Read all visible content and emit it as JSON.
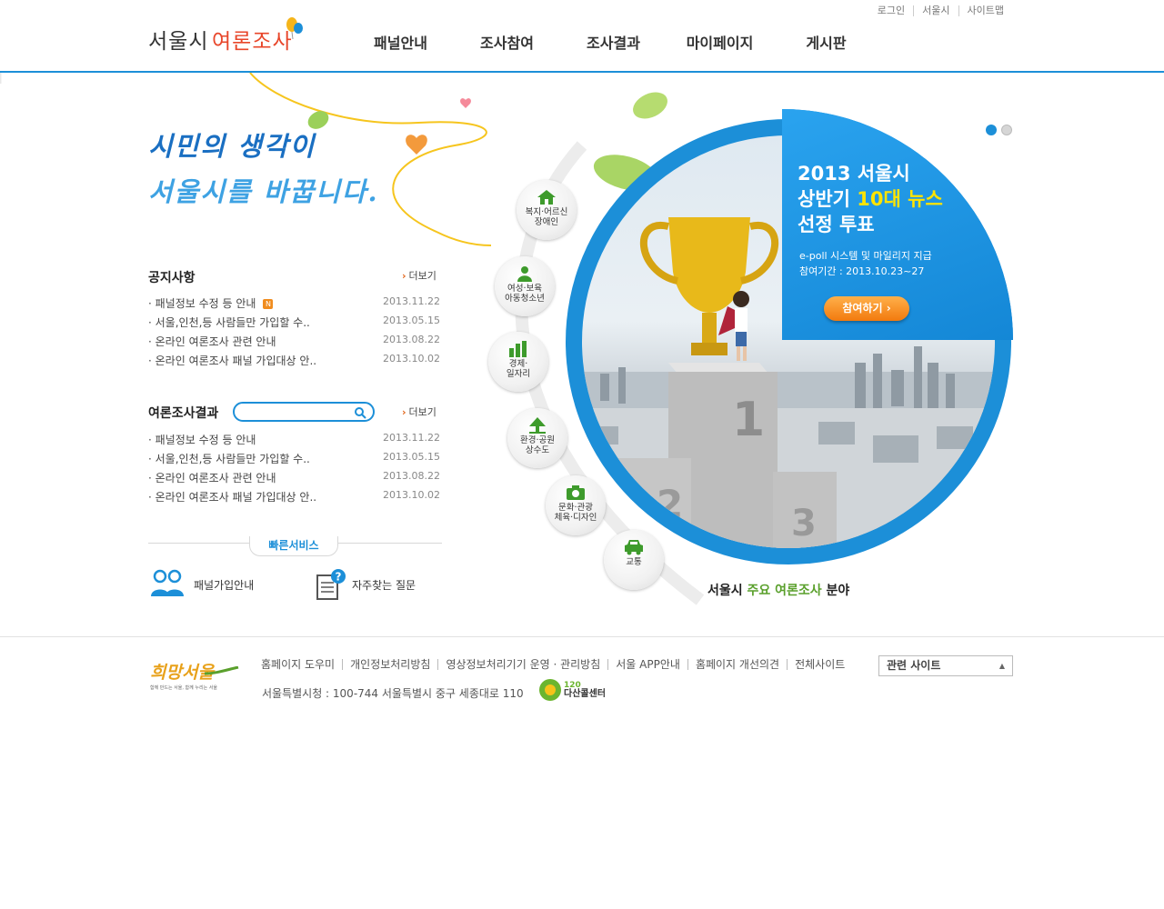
{
  "logo": {
    "part1": "서울시",
    "part2": "여론조사"
  },
  "utility": [
    "로그인",
    "서울시",
    "사이트맵"
  ],
  "gnb": [
    "패널안내",
    "조사참여",
    "조사결과",
    "마이페이지",
    "게시판"
  ],
  "slogan": {
    "line1": "시민의 생각이",
    "line2": "서울시를 바꿉니다."
  },
  "notice": {
    "title": "공지사항",
    "more": "더보기",
    "new_badge": "N",
    "items": [
      {
        "title": "· 패널정보 수정 등 안내",
        "date": "2013.11.22",
        "is_new": true
      },
      {
        "title": "· 서울,인천,등 사람들만 가입할 수..",
        "date": "2013.05.15"
      },
      {
        "title": "· 온라인 여론조사 관련 안내",
        "date": "2013.08.22"
      },
      {
        "title": "· 온라인 여론조사 패널 가입대상 안..",
        "date": "2013.10.02"
      }
    ]
  },
  "results": {
    "title": "여론조사결과",
    "more": "더보기",
    "search_value": "",
    "items": [
      {
        "title": "· 패널정보 수정 등 안내",
        "date": "2013.11.22"
      },
      {
        "title": "· 서울,인천,등 사람들만 가입할 수..",
        "date": "2013.05.15"
      },
      {
        "title": "· 온라인 여론조사 관련 안내",
        "date": "2013.08.22"
      },
      {
        "title": "· 온라인 여론조사 패널 가입대상 안..",
        "date": "2013.10.02"
      }
    ]
  },
  "quick": {
    "title": "빠른서비스",
    "items": [
      "패널가입안내",
      "자주찾는 질문"
    ]
  },
  "categories": [
    {
      "line1": "복지·어르신",
      "line2": "장애인",
      "icon": "house-icon"
    },
    {
      "line1": "여성·보육",
      "line2": "아동청소년",
      "icon": "person-icon"
    },
    {
      "line1": "경제·",
      "line2": "일자리",
      "icon": "bar-chart-icon"
    },
    {
      "line1": "환경·공원",
      "line2": "상수도",
      "icon": "tree-icon"
    },
    {
      "line1": "문화·관광",
      "line2": "체육·디자인",
      "icon": "camera-icon"
    },
    {
      "line1": "교통",
      "line2": "",
      "icon": "car-icon"
    }
  ],
  "banner": {
    "line1": "2013 서울시",
    "line2a": "상반기 ",
    "line2b": "10대 뉴스",
    "line3": "선정 투표",
    "sub1": "e-poll 시스템 및 마일리지 지급",
    "sub2": "참여기간 : 2013.10.23~27",
    "button": "참여하기",
    "pager_active": 1
  },
  "podium": [
    "1",
    "2",
    "3"
  ],
  "caption": {
    "a": "서울시 ",
    "b": "주요 여론조사",
    "c": " 분야"
  },
  "footer": {
    "logo": "희망서울",
    "logo_sub": "함께 만드는 서울, 함께 누리는 서울",
    "links": [
      "홈페이지 도우미",
      "개인정보처리방침",
      "영상정보처리기기 운영 · 관리방침",
      "서울 APP안내",
      "홈페이지 개선의견",
      "전체사이트"
    ],
    "address": "서울특별시청 : 100-744 서울특별시 중구 세종대로 110",
    "dasan_num": "120",
    "dasan_name": "다산콜센터",
    "related": "관련 사이트"
  },
  "colors": {
    "brand_blue": "#1c8fd8",
    "accent_orange": "#f27a0e",
    "accent_yellow": "#ffe400",
    "green": "#5aa02c"
  }
}
